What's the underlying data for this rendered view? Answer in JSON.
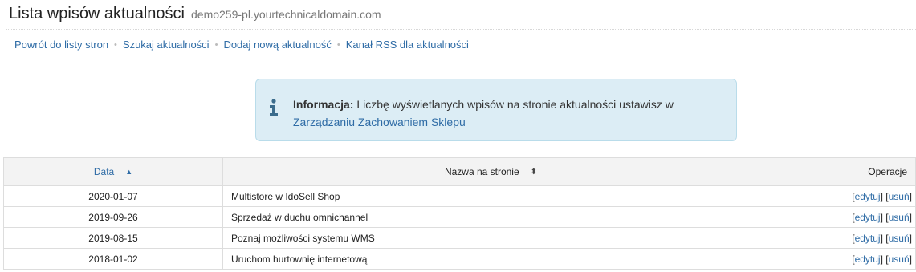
{
  "header": {
    "title": "Lista wpisów aktualności",
    "domain": "demo259-pl.yourtechnicaldomain.com"
  },
  "subnav": {
    "items": [
      {
        "label": "Powrót do listy stron"
      },
      {
        "label": "Szukaj aktualności"
      },
      {
        "label": "Dodaj nową aktualność"
      },
      {
        "label": "Kanał RSS dla aktualności"
      }
    ],
    "separator": "•"
  },
  "info": {
    "icon": "info-icon",
    "label": "Informacja:",
    "text": " Liczbę wyświetlanych wpisów na stronie aktualności ustawisz w ",
    "link": "Zarządzaniu Zachowaniem Sklepu",
    "colors": {
      "background": "#dcedf5",
      "border": "#b9dcea",
      "icon": "#3b6c8c"
    }
  },
  "table": {
    "columns": {
      "date": "Data",
      "name": "Nazwa na stronie",
      "ops": "Operacje"
    },
    "sort_icons": {
      "date": "sort-ascending-icon",
      "name": "sort-both-icon"
    },
    "rows": [
      {
        "date": "2020-01-07",
        "name": "Multistore w IdoSell Shop",
        "edit": "edytuj",
        "delete": "usuń"
      },
      {
        "date": "2019-09-26",
        "name": "Sprzedaż w duchu omnichannel",
        "edit": "edytuj",
        "delete": "usuń"
      },
      {
        "date": "2019-08-15",
        "name": "Poznaj możliwości systemu WMS",
        "edit": "edytuj",
        "delete": "usuń"
      },
      {
        "date": "2018-01-02",
        "name": "Uruchom hurtownię internetową",
        "edit": "edytuj",
        "delete": "usuń"
      }
    ]
  }
}
